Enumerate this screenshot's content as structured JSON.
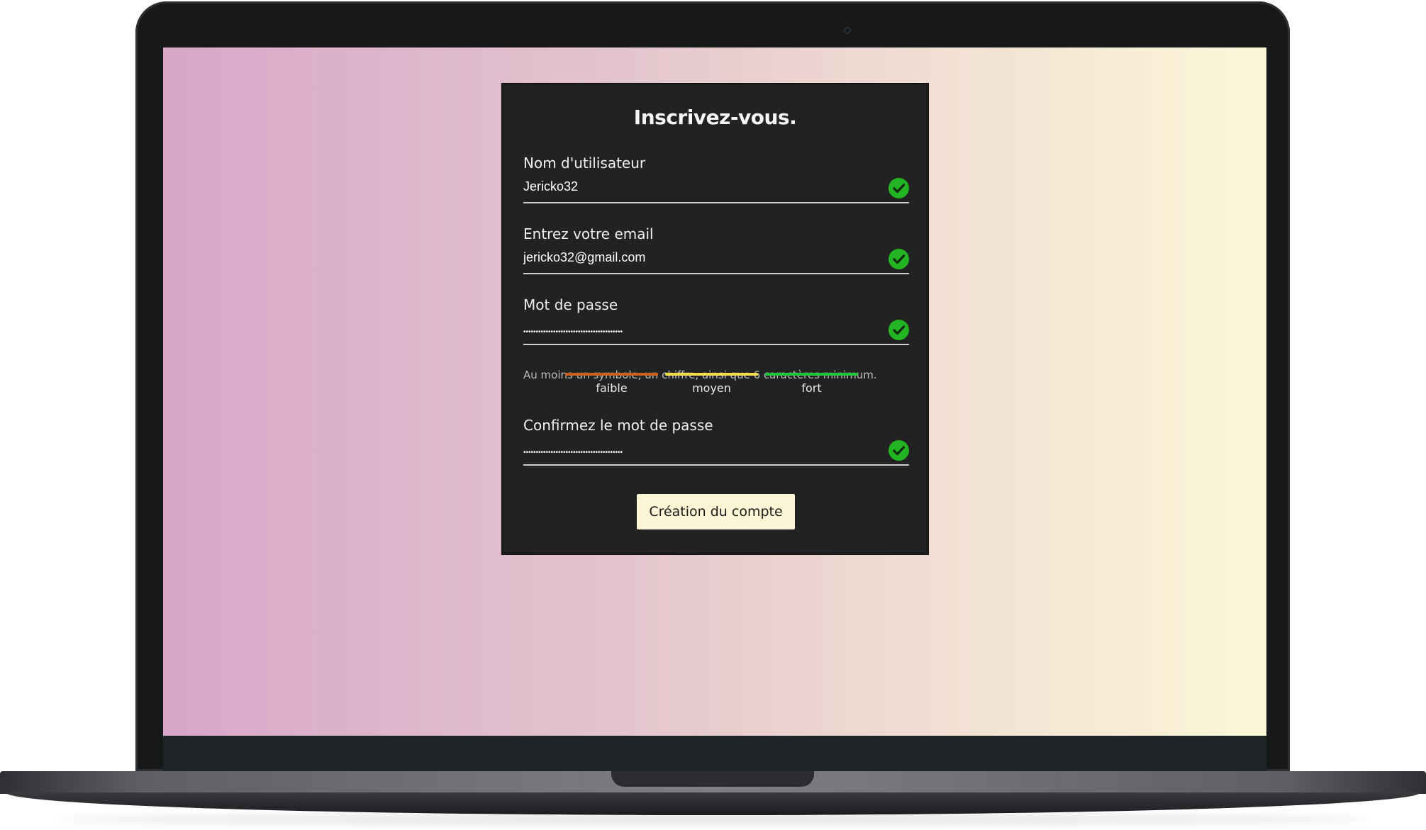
{
  "form": {
    "title": "Inscrivez-vous.",
    "fields": [
      {
        "label": "Nom d'utilisateur",
        "value": "Jericko32",
        "valid": true
      },
      {
        "label": "Entrez votre email",
        "value": "jericko32@gmail.com",
        "valid": true
      },
      {
        "label": "Mot de passe",
        "value": "••••••••••••••••••••••••••••••••••••••••",
        "valid": true
      },
      {
        "label": "Confirmez le mot de passe",
        "value": "••••••••••••••••••••••••••••••••••••••••",
        "valid": true
      }
    ],
    "password_hint": "Au moins un symbole, un chiffre, ainsi que 6 caractères minimum.",
    "strength": [
      {
        "label": "faible",
        "color": "#c9611f"
      },
      {
        "label": "moyen",
        "color": "#eedc4b"
      },
      {
        "label": "fort",
        "color": "#22c43a"
      }
    ],
    "submit_label": "Création du compte"
  },
  "colors": {
    "card_bg": "#222222",
    "valid_icon": "#22b422",
    "button_bg": "#fdf6d6"
  }
}
